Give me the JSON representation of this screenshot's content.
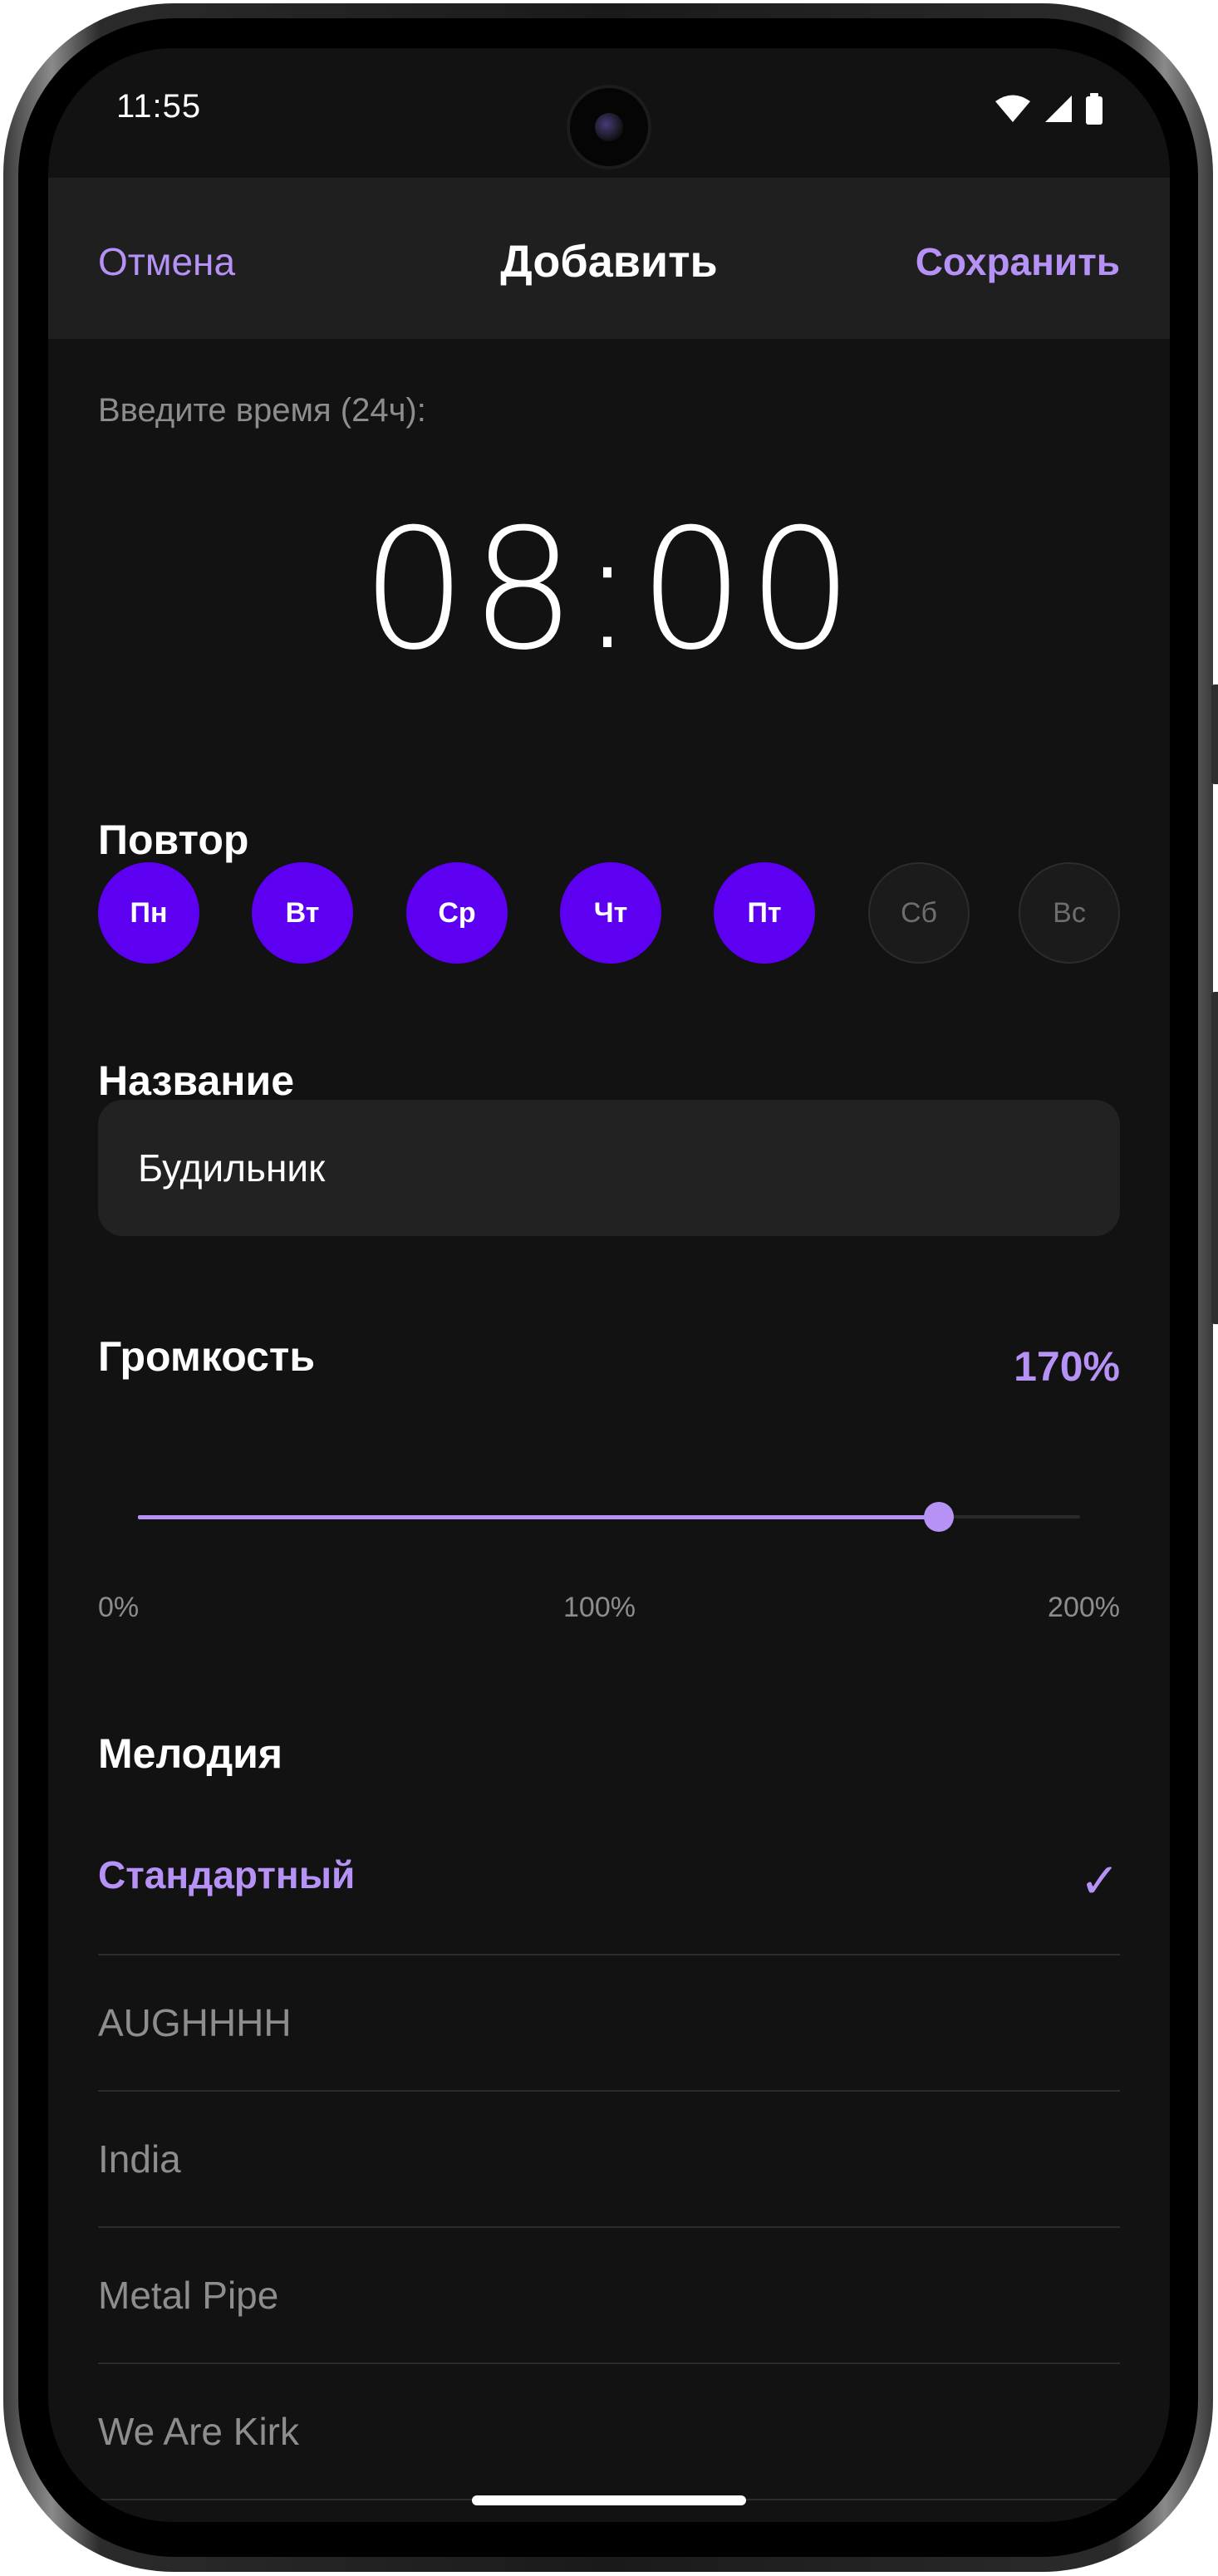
{
  "status_bar": {
    "time": "11:55"
  },
  "nav": {
    "cancel_label": "Отмена",
    "title": "Добавить",
    "save_label": "Сохранить"
  },
  "time_entry": {
    "label": "Введите время (24ч):",
    "value": "08:00"
  },
  "repeat": {
    "title": "Повтор",
    "days": [
      {
        "label": "Пн",
        "selected": true
      },
      {
        "label": "Вт",
        "selected": true
      },
      {
        "label": "Ср",
        "selected": true
      },
      {
        "label": "Чт",
        "selected": true
      },
      {
        "label": "Пт",
        "selected": true
      },
      {
        "label": "Сб",
        "selected": false
      },
      {
        "label": "Вс",
        "selected": false
      }
    ]
  },
  "name": {
    "title": "Название",
    "value": "Будильник"
  },
  "volume": {
    "title": "Громкость",
    "value_label": "170%",
    "percent": 170,
    "max_percent": 200,
    "ticks": [
      "0%",
      "100%",
      "200%"
    ]
  },
  "melody": {
    "title": "Мелодия",
    "items": [
      {
        "label": "Стандартный",
        "selected": true
      },
      {
        "label": "AUGHHHH",
        "selected": false
      },
      {
        "label": "India",
        "selected": false
      },
      {
        "label": "Metal Pipe",
        "selected": false
      },
      {
        "label": "We Are Kirk",
        "selected": false
      }
    ],
    "check_glyph": "✓"
  },
  "colors": {
    "accent": "#b692f6",
    "day_selected": "#5d00f2",
    "background": "#121212",
    "surface": "#1f1f1f"
  }
}
